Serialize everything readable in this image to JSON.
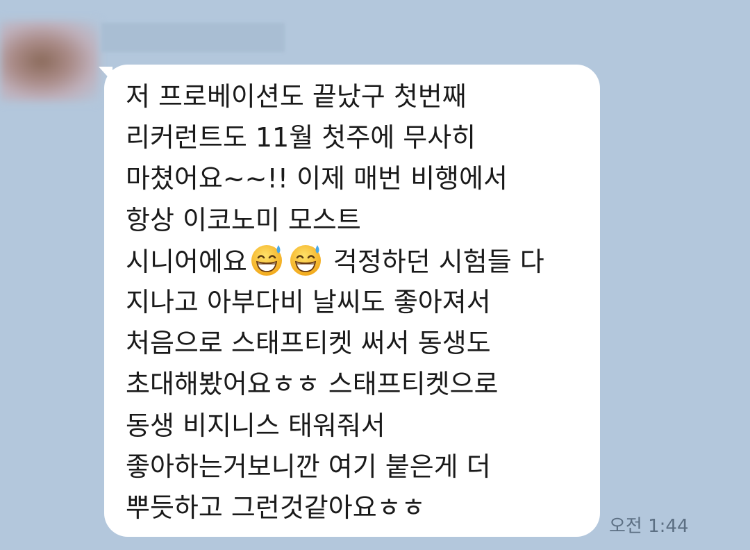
{
  "chat": {
    "sender_name": "",
    "message": {
      "lines": [
        {
          "text": "저 프로베이션도 끝났구 첫번째"
        },
        {
          "text": "리커런트도 11월 첫주에 무사히"
        },
        {
          "text": "마쳤어요~~!! 이제 매번 비행에서"
        },
        {
          "text": "항상 이코노미 모스트"
        },
        {
          "before": "시니어에요",
          "emoji_count": 2,
          "emoji": "grinning-sweat-emoji",
          "after": " 걱정하던 시험들 다"
        },
        {
          "text": "지나고 아부다비 날씨도 좋아져서"
        },
        {
          "text": "처음으로 스태프티켓 써서 동생도"
        },
        {
          "text": "초대해봤어요ㅎㅎ 스태프티켓으로"
        },
        {
          "text": "동생 비지니스 태워줘서"
        },
        {
          "text": "좋아하는거보니깐 여기 붙은게 더"
        },
        {
          "text": "뿌듯하고 그런것같아요ㅎㅎ"
        }
      ]
    },
    "timestamp": "오전 1:44"
  },
  "colors": {
    "background": "#b3c7dc",
    "bubble": "#ffffff",
    "text": "#1a1a1a",
    "timestamp": "#5c6f83"
  }
}
